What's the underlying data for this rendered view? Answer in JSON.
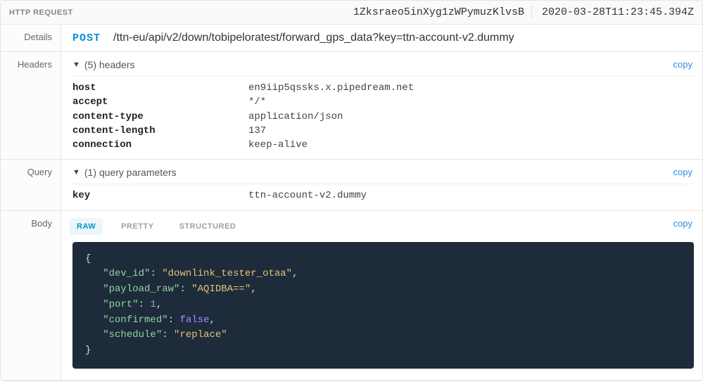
{
  "header": {
    "title": "HTTP REQUEST",
    "id": "1Zksraeo5inXyg1zWPymuzKlvsB",
    "timestamp": "2020-03-28T11:23:45.394Z"
  },
  "labels": {
    "details": "Details",
    "headers": "Headers",
    "query": "Query",
    "body": "Body",
    "copy": "copy"
  },
  "details": {
    "method": "POST",
    "path": "/ttn-eu/api/v2/down/tobipeloratest/forward_gps_data?key=ttn-account-v2.dummy"
  },
  "headersSection": {
    "summary": "(5) headers",
    "items": [
      {
        "k": "host",
        "v": "en9iip5qssks.x.pipedream.net"
      },
      {
        "k": "accept",
        "v": "*/*"
      },
      {
        "k": "content-type",
        "v": "application/json"
      },
      {
        "k": "content-length",
        "v": "137"
      },
      {
        "k": "connection",
        "v": "keep-alive"
      }
    ]
  },
  "querySection": {
    "summary": "(1) query parameters",
    "items": [
      {
        "k": "key",
        "v": "ttn-account-v2.dummy"
      }
    ]
  },
  "bodySection": {
    "tabs": {
      "raw": "RAW",
      "pretty": "PRETTY",
      "structured": "STRUCTURED"
    },
    "json": {
      "dev_id": "downlink_tester_otaa",
      "payload_raw": "AQIDBA==",
      "port": 1,
      "confirmed": false,
      "schedule": "replace"
    }
  }
}
